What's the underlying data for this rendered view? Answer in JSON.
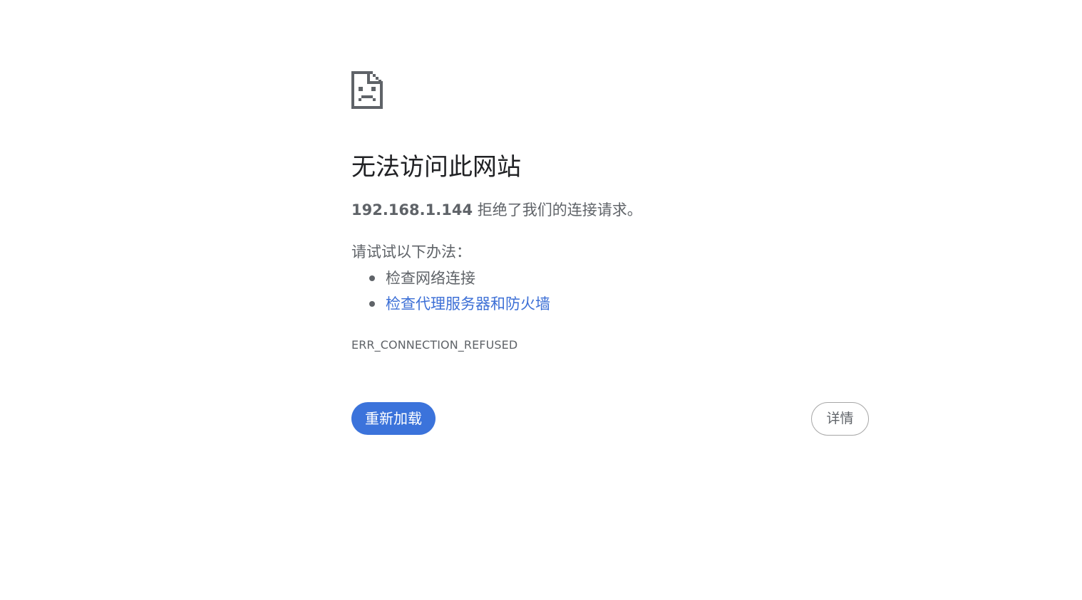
{
  "icon": {
    "name": "sad-page-icon",
    "color": "#5f6368"
  },
  "main": {
    "title": "无法访问此网站",
    "summary": {
      "host": "192.168.1.144",
      "message": " 拒绝了我们的连接请求。"
    },
    "suggestions": {
      "heading": "请试试以下办法：",
      "items": [
        {
          "label": "检查网络连接",
          "is_link": false
        },
        {
          "label": "检查代理服务器和防火墙",
          "is_link": true
        }
      ]
    },
    "error_code": "ERR_CONNECTION_REFUSED"
  },
  "buttons": {
    "reload_label": "重新加载",
    "details_label": "详情"
  },
  "colors": {
    "primary_button": "#3b73db",
    "link": "#3c6fd6",
    "text_secondary": "#5f6368",
    "title": "#202124"
  }
}
